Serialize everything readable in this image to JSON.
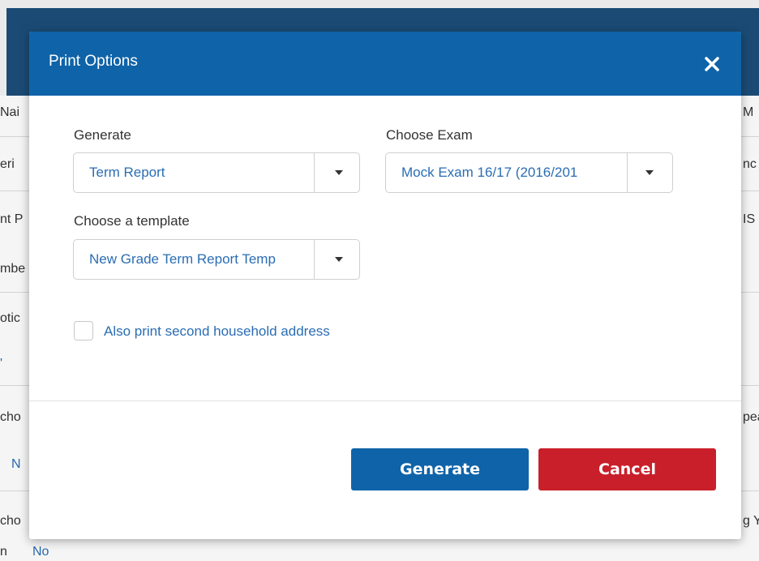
{
  "background": {
    "left_column": [
      "Nai",
      "eri",
      "nt P",
      "mbe",
      "otic",
      "'",
      "cho",
      "N",
      "cho",
      "n"
    ],
    "right_column": [
      "M",
      "nc",
      "IS",
      "pea",
      "g Y"
    ],
    "bottom_left": "No"
  },
  "dialog": {
    "title": "Print Options",
    "close_icon": "close-icon",
    "generate": {
      "label": "Generate",
      "value": "Term Report"
    },
    "exam": {
      "label": "Choose Exam",
      "value": "Mock Exam 16/17 (2016/201"
    },
    "template": {
      "label": "Choose a template",
      "value": "New Grade Term Report Temp"
    },
    "checkbox": {
      "label": "Also print second household address",
      "checked": false
    },
    "buttons": {
      "generate": "Generate",
      "cancel": "Cancel"
    }
  },
  "colors": {
    "header_blue": "#0f63a8",
    "cancel_red": "#c91f2a",
    "link_blue": "#2a6db3"
  }
}
